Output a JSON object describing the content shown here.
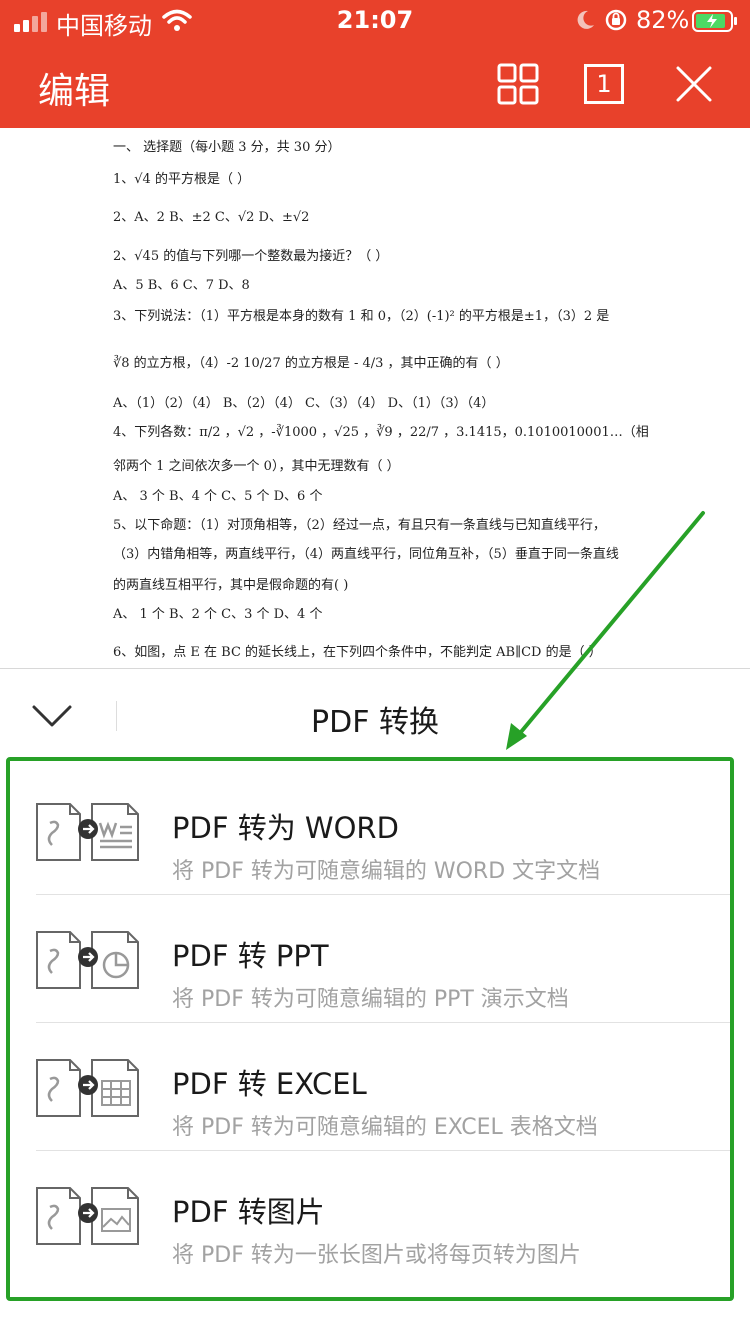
{
  "status_bar": {
    "carrier": "中国移动",
    "time": "21:07",
    "battery_percent": "82%"
  },
  "header": {
    "title": "编辑",
    "page_count": "1",
    "icons": [
      "grid-icon",
      "page-count-icon",
      "close-icon"
    ]
  },
  "document": {
    "lines": [
      "一、      选择题（每小题 3 分，共 30 分）",
      "1、√4 的平方根是（      ）",
      "2、A、2          B、±2          C、√2          D、±√2",
      "2、√45 的值与下列哪一个整数最为接近？（        ）",
      "    A、5          B、6          C、7          D、8",
      "3、下列说法：（1）平方根是本身的数有 1 和 0，（2）(-1)² 的平方根是±1，（3）2 是",
      "∛8 的立方根，（4）-2 10/27 的立方根是 - 4/3 ，其中正确的有（      ）",
      "    A、（1）（2）（4）      B、（2）（4）      C、（3）（4）      D、（1）（3）（4）",
      "4、下列各数：π/2 ，√2 ，-∛1000 ，√25 ，∛9 ，22/7 ，3.1415，0.1010010001…（相",
      "邻两个 1 之间依次多一个 0），其中无理数有（      ）",
      "  A、 3 个              B、4 个          C、5 个          D、6 个",
      "5、以下命题：（1）对顶角相等，（2）经过一点，有且只有一条直线与已知直线平行，",
      "（3）内错角相等，两直线平行，（4）两直线平行，同位角互补，（5）垂直于同一条直线",
      "的两直线互相平行，其中是假命题的有(      )",
      "    A、  1 个              B、2 个          C、3 个          D、4 个",
      "6、如图，点 E 在 BC 的延长线上，在下列四个条件中，不能判定 AB∥CD 的是（      ）"
    ]
  },
  "sheet": {
    "title": "PDF 转换",
    "collapse_icon": "chevron-down-icon",
    "highlight_color": "#27a127",
    "options": [
      {
        "name": "PDF 转为 WORD",
        "desc": "将 PDF 转为可随意编辑的 WORD 文字文档",
        "icon": "pdf-to-word-icon"
      },
      {
        "name": "PDF 转 PPT",
        "desc": "将 PDF 转为可随意编辑的 PPT 演示文档",
        "icon": "pdf-to-ppt-icon"
      },
      {
        "name": "PDF 转 EXCEL",
        "desc": "将 PDF 转为可随意编辑的 EXCEL 表格文档",
        "icon": "pdf-to-excel-icon"
      },
      {
        "name": "PDF 转图片",
        "desc": "将 PDF 转为一张长图片或将每页转为图片",
        "icon": "pdf-to-image-icon"
      }
    ]
  },
  "colors": {
    "header_bg": "#e8412b",
    "annotation_green": "#27a127"
  }
}
